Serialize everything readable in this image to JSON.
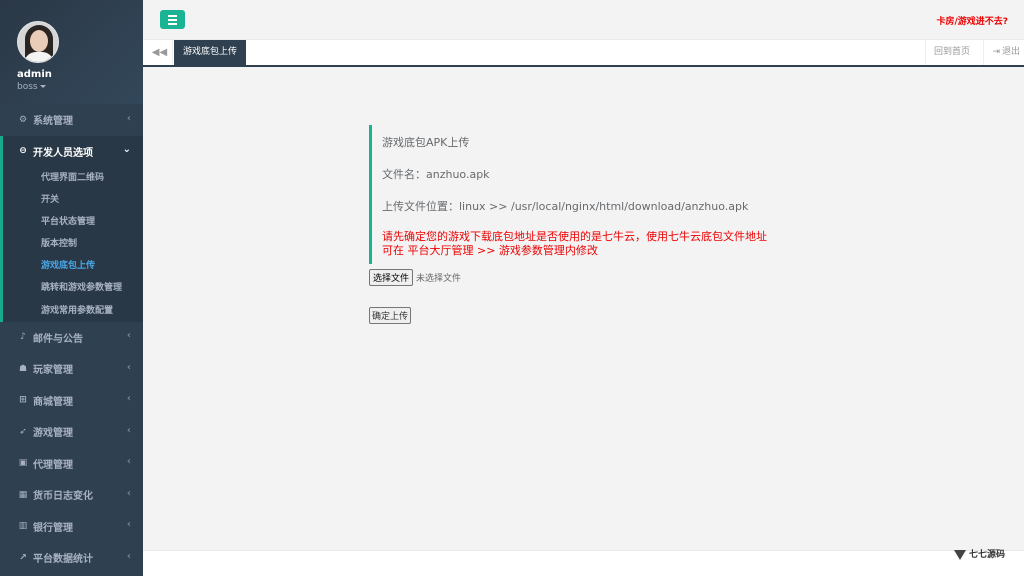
{
  "profile": {
    "name": "admin",
    "role": "boss"
  },
  "sidebar": {
    "items": [
      {
        "icon": "gears-icon",
        "glyph": "⚙",
        "label": "系统管理"
      },
      {
        "icon": "gamepad-icon",
        "glyph": "●",
        "label": "开发人员选项",
        "expanded": true,
        "children": [
          {
            "label": "代理界面二维码"
          },
          {
            "label": "开关"
          },
          {
            "label": "平台状态管理"
          },
          {
            "label": "版本控制"
          },
          {
            "label": "游戏底包上传",
            "active": true
          },
          {
            "label": "跳转和游戏参数管理"
          },
          {
            "label": "游戏常用参数配置"
          }
        ]
      },
      {
        "icon": "bell-icon",
        "glyph": "♪",
        "label": "邮件与公告"
      },
      {
        "icon": "user-icon",
        "glyph": "●",
        "label": "玩家管理"
      },
      {
        "icon": "cart-icon",
        "glyph": "▰",
        "label": "商城管理"
      },
      {
        "icon": "rocket-icon",
        "glyph": "➤",
        "label": "游戏管理"
      },
      {
        "icon": "lock-icon",
        "glyph": "▣",
        "label": "代理管理"
      },
      {
        "icon": "calendar-icon",
        "glyph": "▦",
        "label": "货币日志变化"
      },
      {
        "icon": "bank-icon",
        "glyph": "▥",
        "label": "银行管理"
      },
      {
        "icon": "chart-icon",
        "glyph": "↗",
        "label": "平台数据统计"
      }
    ]
  },
  "topbar": {
    "link": "卡房/游戏进不去?"
  },
  "tabs": {
    "active": "游戏底包上传",
    "home": "回到首页",
    "logout": "退出"
  },
  "upload": {
    "title": "游戏底包APK上传",
    "filename": "文件名：anzhuo.apk",
    "location": "上传文件位置：linux >> /usr/local/nginx/html/download/anzhuo.apk",
    "warning_line1": "请先确定您的游戏下载底包地址是否使用的是七牛云，使用七牛云底包文件地址",
    "warning_line2": "可在 平台大厅管理 >> 游戏参数管理内修改",
    "choose_file": "选择文件",
    "no_file": "未选择文件",
    "submit": "确定上传"
  },
  "watermark": {
    "text": "七七源码"
  },
  "colors": {
    "sidebar": "#2f4050",
    "accent": "#1ab394",
    "warning": "#ed0202",
    "active_link": "#4aa7e8"
  }
}
